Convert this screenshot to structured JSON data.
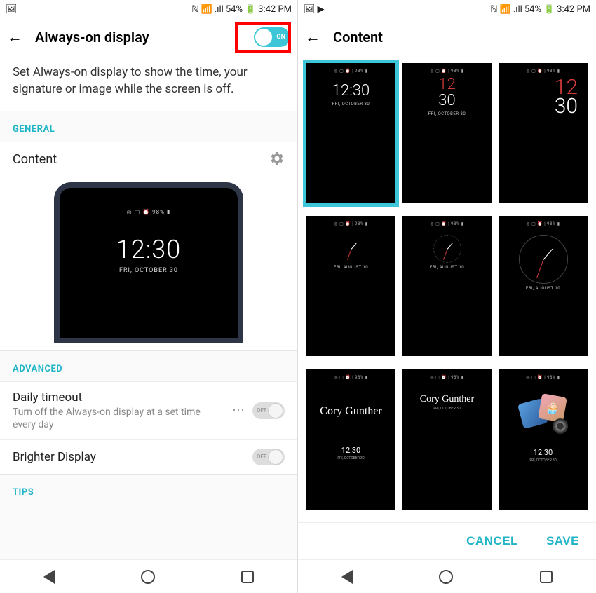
{
  "status": {
    "left_icons": [
      "🖼"
    ],
    "left_icons_b": [
      "🖼",
      "▶"
    ],
    "nfc": "ℕ",
    "wifi": "▾",
    "signal": "📶",
    "battery_pct": "54%",
    "batt_icon": "🔋",
    "time": "3:42 PM"
  },
  "left": {
    "title": "Always-on display",
    "toggle_label": "ON",
    "description": "Set Always-on display to show the time, your signature or image while the screen is off.",
    "section_general": "GENERAL",
    "content_label": "Content",
    "preview": {
      "icons": "◎ ▢ ⏰  98% ▮",
      "time": "12:30",
      "date": "FRI, OCTOBER 30"
    },
    "section_advanced": "ADVANCED",
    "daily_timeout": {
      "title": "Daily timeout",
      "sub": "Turn off the Always-on display at a set time every day",
      "toggle": "OFF"
    },
    "brighter": {
      "title": "Brighter Display",
      "toggle": "OFF"
    },
    "section_tips": "TIPS"
  },
  "right": {
    "title": "Content",
    "thumbs": {
      "icons": "◎ ▢ ⏰ | 98% ▮",
      "t1": {
        "time": "12:30",
        "date": "FRI, OCTOBER 30"
      },
      "t2": {
        "h": "12",
        "m": "30",
        "date": "FRI, OCTOBER 30"
      },
      "t3": {
        "h": "12",
        "m": "30"
      },
      "t4": {
        "date": "FRI, AUGUST 10"
      },
      "t5": {
        "date": "FRI, AUGUST 10"
      },
      "t6": {
        "date": "FRI, AUGUST 10"
      },
      "t7": {
        "sig": "Cory Gunther",
        "time": "12:30",
        "date": "FRI, OCTOBER 30"
      },
      "t8": {
        "sig": "Cory Gunther",
        "date": "FRI, OCTOBER 30"
      },
      "t9": {
        "time": "12:30",
        "date": "FRI, OCTOBER 30"
      }
    },
    "cancel": "CANCEL",
    "save": "SAVE"
  }
}
